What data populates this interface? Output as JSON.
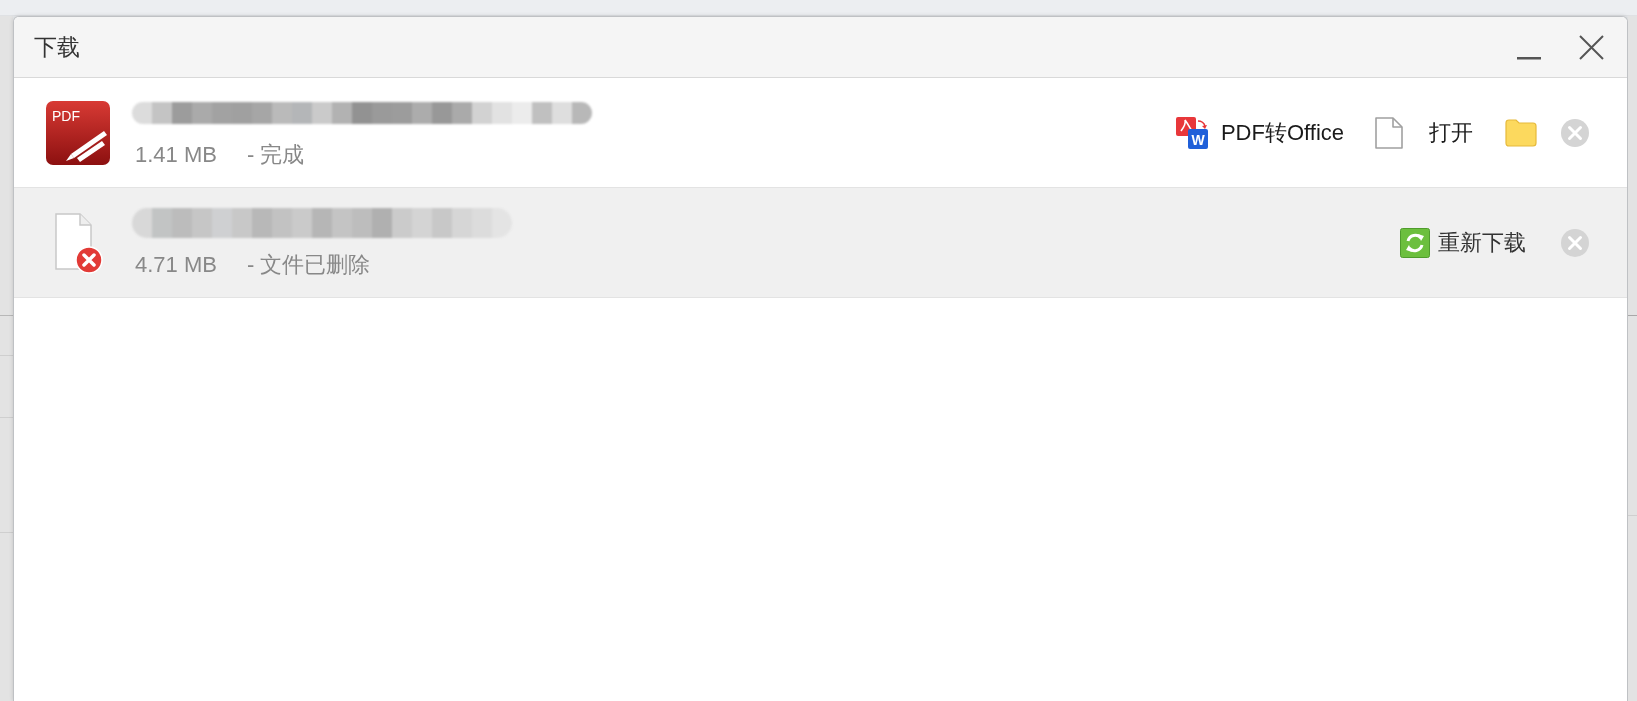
{
  "window": {
    "title": "下载"
  },
  "downloads": [
    {
      "kind": "pdf",
      "icon_label": "PDF",
      "size": "1.41 MB",
      "status": "- 完成",
      "highlighted": false,
      "actions": [
        {
          "kind": "convert",
          "badge": "W",
          "label": "PDF转Office"
        },
        {
          "kind": "open",
          "label": "打开"
        },
        {
          "kind": "folder"
        }
      ]
    },
    {
      "kind": "deleted",
      "size": "4.71 MB",
      "status": "- 文件已删除",
      "highlighted": true,
      "actions": [
        {
          "kind": "redownload",
          "label": "重新下载"
        }
      ]
    }
  ]
}
